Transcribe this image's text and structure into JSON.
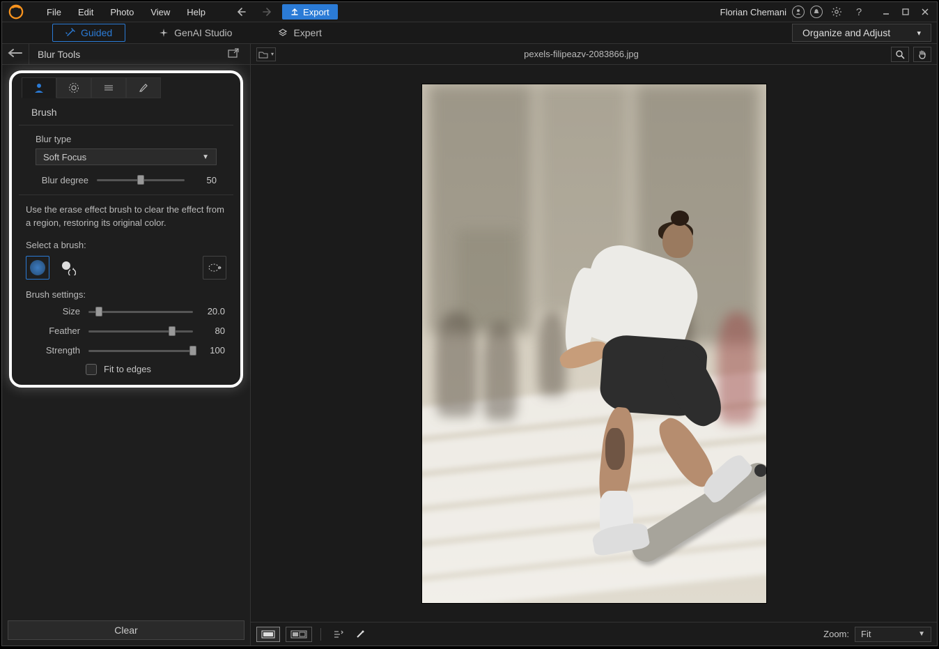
{
  "menu": {
    "file": "File",
    "edit": "Edit",
    "photo": "Photo",
    "view": "View",
    "help": "Help"
  },
  "titlebar": {
    "export": "Export",
    "user": "Florian Chemani"
  },
  "modebar": {
    "guided": "Guided",
    "genai": "GenAI Studio",
    "expert": "Expert",
    "organize": "Organize and Adjust"
  },
  "sidebar": {
    "title": "Blur Tools",
    "section": "Brush",
    "blur_type_label": "Blur type",
    "blur_type_value": "Soft Focus",
    "blur_degree_label": "Blur degree",
    "blur_degree_value": "50",
    "erase_help": "Use the erase effect brush to clear the effect from a region, restoring its original color.",
    "select_brush": "Select a brush:",
    "brush_settings": "Brush settings:",
    "size_label": "Size",
    "size_value": "20.0",
    "feather_label": "Feather",
    "feather_value": "80",
    "strength_label": "Strength",
    "strength_value": "100",
    "fit_edges": "Fit to edges",
    "clear": "Clear"
  },
  "canvas": {
    "filename": "pexels-filipeazv-2083866.jpg",
    "zoom_label": "Zoom:",
    "zoom_value": "Fit"
  }
}
